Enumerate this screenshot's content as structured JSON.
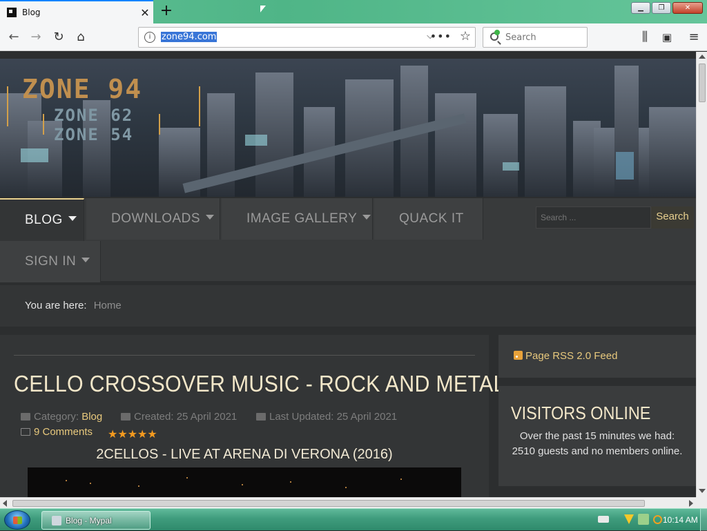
{
  "browser": {
    "tab_title": "Blog",
    "url": "zone94.com",
    "search_placeholder": "Search"
  },
  "site": {
    "logo": [
      "ZONE 94",
      "ZONE 62",
      "ZONE 54"
    ],
    "menu": [
      {
        "label": "BLOG",
        "has_dropdown": true,
        "active": true
      },
      {
        "label": "DOWNLOADS",
        "has_dropdown": true,
        "active": false
      },
      {
        "label": "IMAGE GALLERY",
        "has_dropdown": true,
        "active": false
      },
      {
        "label": "QUACK IT",
        "has_dropdown": false,
        "active": false
      },
      {
        "label": "SIGN IN",
        "has_dropdown": true,
        "active": false
      }
    ],
    "search_placeholder": "Search ...",
    "search_button": "Search",
    "breadcrumb": {
      "prefix": "You are here:",
      "home": "Home"
    }
  },
  "article": {
    "title": "CELLO CROSSOVER MUSIC - ROCK AND METAL",
    "category_label": "Category:",
    "category": "Blog",
    "created": "Created: 25 April 2021",
    "updated": "Last Updated: 25 April 2021",
    "comments": "9 Comments",
    "rating": 5,
    "subtitle": "2CELLOS - LIVE AT ARENA DI VERONA (2016)"
  },
  "sidebar": {
    "rss": "Page RSS 2.0 Feed",
    "visitors_title": "VISITORS ONLINE",
    "visitors_text": "Over the past 15 minutes we had: 2510 guests and no members online."
  },
  "taskbar": {
    "task_label": "Blog - Mypal",
    "clock": "10:14 AM"
  },
  "colors": {
    "accent_gold": "#e8c97d",
    "title_cream": "#f3e7c9",
    "star_orange": "#f39a1f"
  }
}
